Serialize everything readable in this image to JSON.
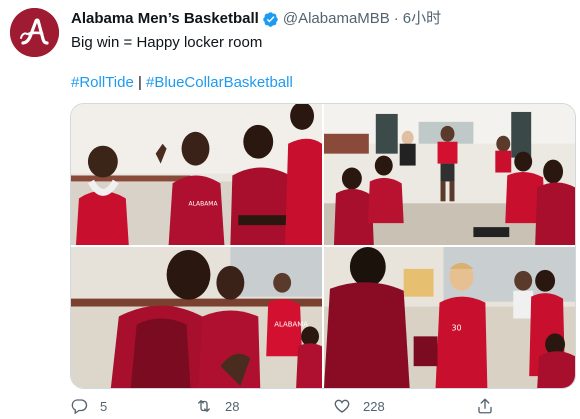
{
  "tweet": {
    "display_name": "Alabama Men’s Basketball",
    "handle": "@AlabamaMBB",
    "separator": "·",
    "time": "6小时",
    "text": "Big win = Happy locker room",
    "hashtag_1": "#RollTide",
    "hashtag_sep": " | ",
    "hashtag_2": "#BlueCollarBasketball",
    "jersey_1": "ALABAMA",
    "jersey_2": "ALABAMA",
    "jersey_3": "30"
  },
  "actions": {
    "reply_count": "5",
    "retweet_count": "28",
    "like_count": "228"
  },
  "icons": {
    "avatar": "alabama-script-a-logo",
    "verified": "verified-badge-icon",
    "reply": "reply-icon",
    "retweet": "retweet-icon",
    "like": "like-icon",
    "share": "share-icon"
  },
  "colors": {
    "brand_crimson": "#9e1b32",
    "link_blue": "#1d9bf0",
    "verified_blue": "#1d9bf0",
    "muted_text": "#536471"
  }
}
